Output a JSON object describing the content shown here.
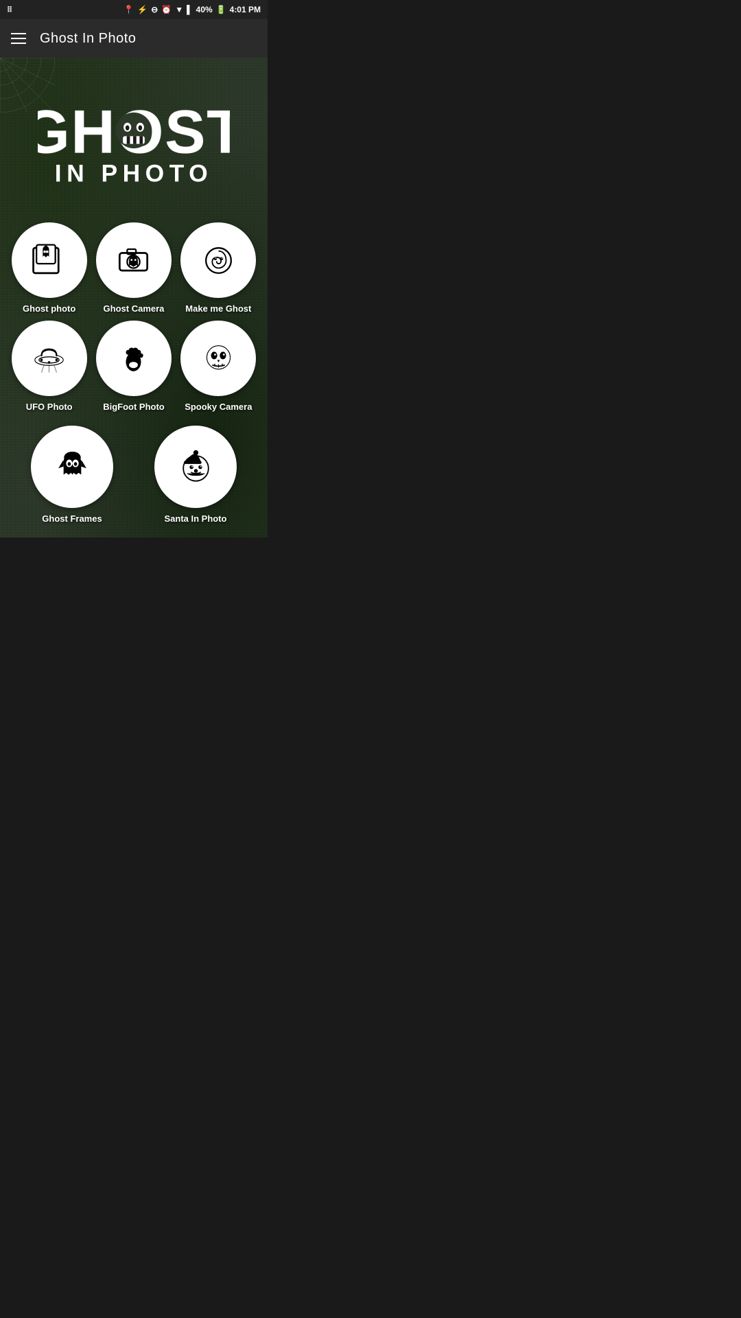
{
  "statusBar": {
    "time": "4:01 PM",
    "battery": "40%",
    "signal": "signals"
  },
  "appBar": {
    "title": "Ghost In Photo",
    "menuIcon": "☰"
  },
  "logo": {
    "line1": "GHOST",
    "line2": "IN PHOTO"
  },
  "gridItems": [
    {
      "id": "ghost-photo",
      "label": "Ghost photo",
      "icon": "ghost-photo-icon"
    },
    {
      "id": "ghost-camera",
      "label": "Ghost Camera",
      "icon": "ghost-camera-icon"
    },
    {
      "id": "make-me-ghost",
      "label": "Make me Ghost",
      "icon": "make-me-ghost-icon"
    },
    {
      "id": "ufo-photo",
      "label": "UFO Photo",
      "icon": "ufo-icon"
    },
    {
      "id": "bigfoot-photo",
      "label": "BigFoot Photo",
      "icon": "bigfoot-icon"
    },
    {
      "id": "spooky-camera",
      "label": "Spooky Camera",
      "icon": "spooky-camera-icon"
    }
  ],
  "bottomItems": [
    {
      "id": "ghost-frames",
      "label": "Ghost Frames",
      "icon": "ghost-frames-icon"
    },
    {
      "id": "santa-in-photo",
      "label": "Santa In Photo",
      "icon": "santa-icon"
    }
  ]
}
